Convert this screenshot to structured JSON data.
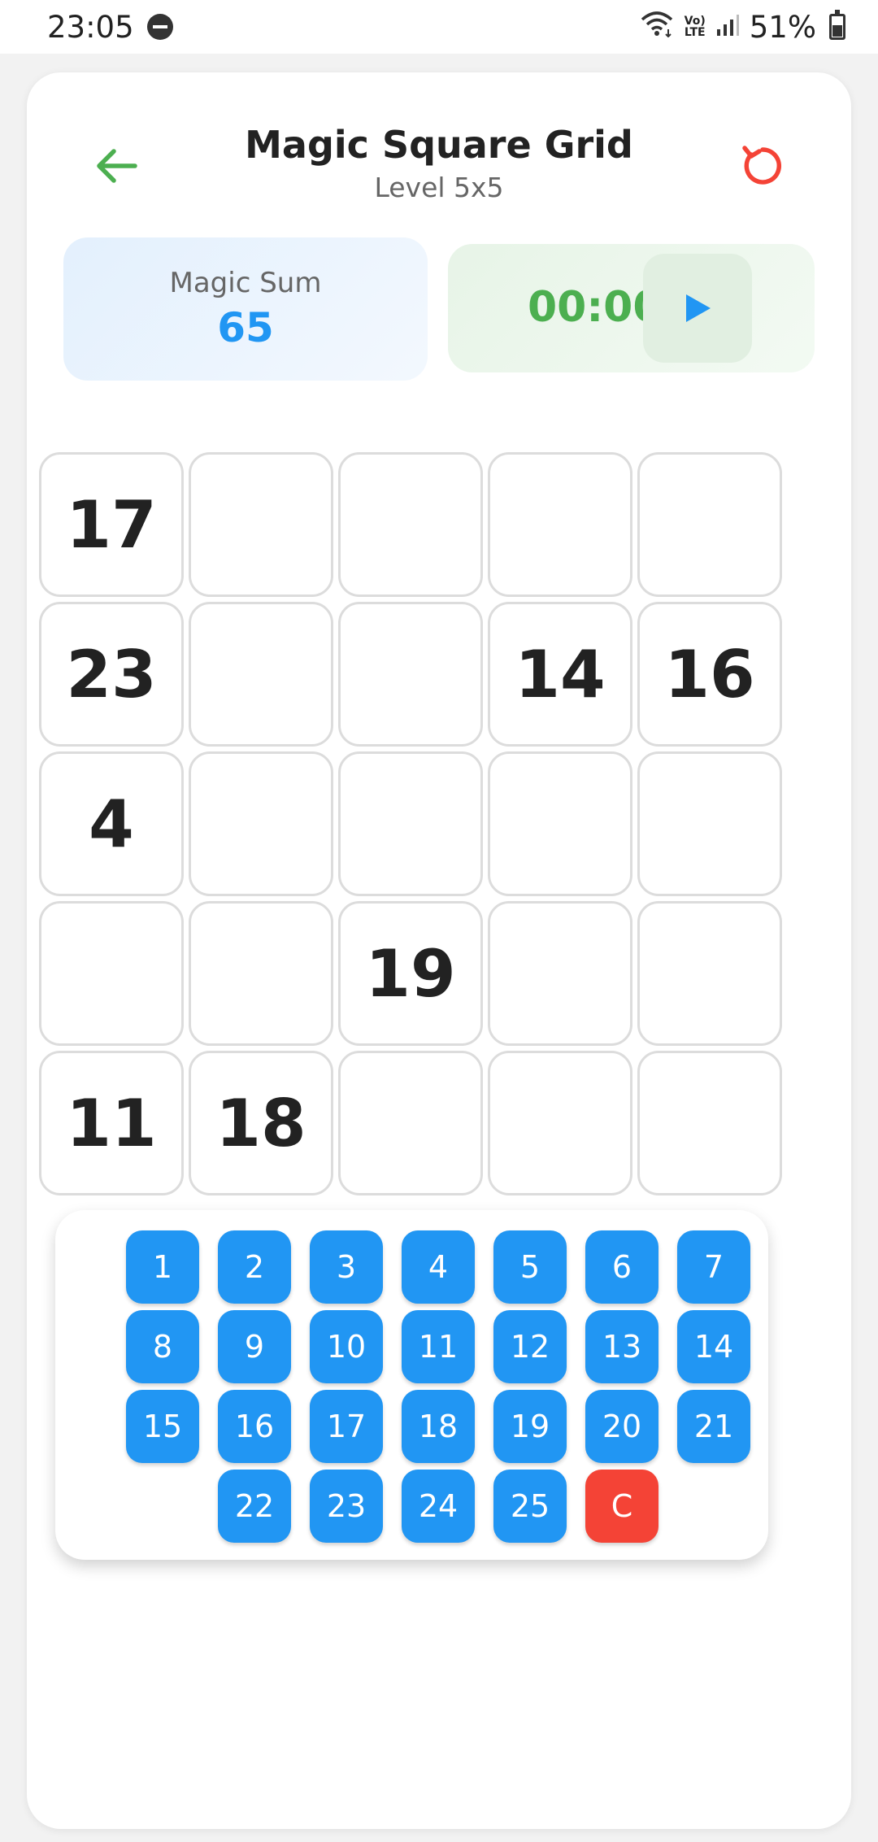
{
  "status_bar": {
    "time": "23:05",
    "volte_top": "Vo)",
    "volte_bottom": "LTE",
    "battery": "51%"
  },
  "header": {
    "title": "Magic Square Grid",
    "subtitle": "Level 5x5",
    "back_icon": "arrow-left-icon",
    "reset_icon": "refresh-icon"
  },
  "magic_sum": {
    "label": "Magic Sum",
    "value": "65"
  },
  "timer": {
    "value": "00:00",
    "play_icon": "play-icon"
  },
  "grid": {
    "rows": [
      [
        "17",
        "",
        "",
        "",
        ""
      ],
      [
        "23",
        "",
        "",
        "14",
        "16"
      ],
      [
        "4",
        "",
        "",
        "",
        ""
      ],
      [
        "",
        "",
        "19",
        "",
        ""
      ],
      [
        "11",
        "18",
        "",
        "",
        ""
      ]
    ]
  },
  "keypad": {
    "keys": [
      "1",
      "2",
      "3",
      "4",
      "5",
      "6",
      "7",
      "8",
      "9",
      "10",
      "11",
      "12",
      "13",
      "14",
      "15",
      "16",
      "17",
      "18",
      "19",
      "20",
      "21",
      "22",
      "23",
      "24",
      "25"
    ],
    "clear_label": "C"
  },
  "colors": {
    "accent_blue": "#2196f3",
    "accent_green": "#4caf50",
    "accent_red": "#f44336"
  }
}
